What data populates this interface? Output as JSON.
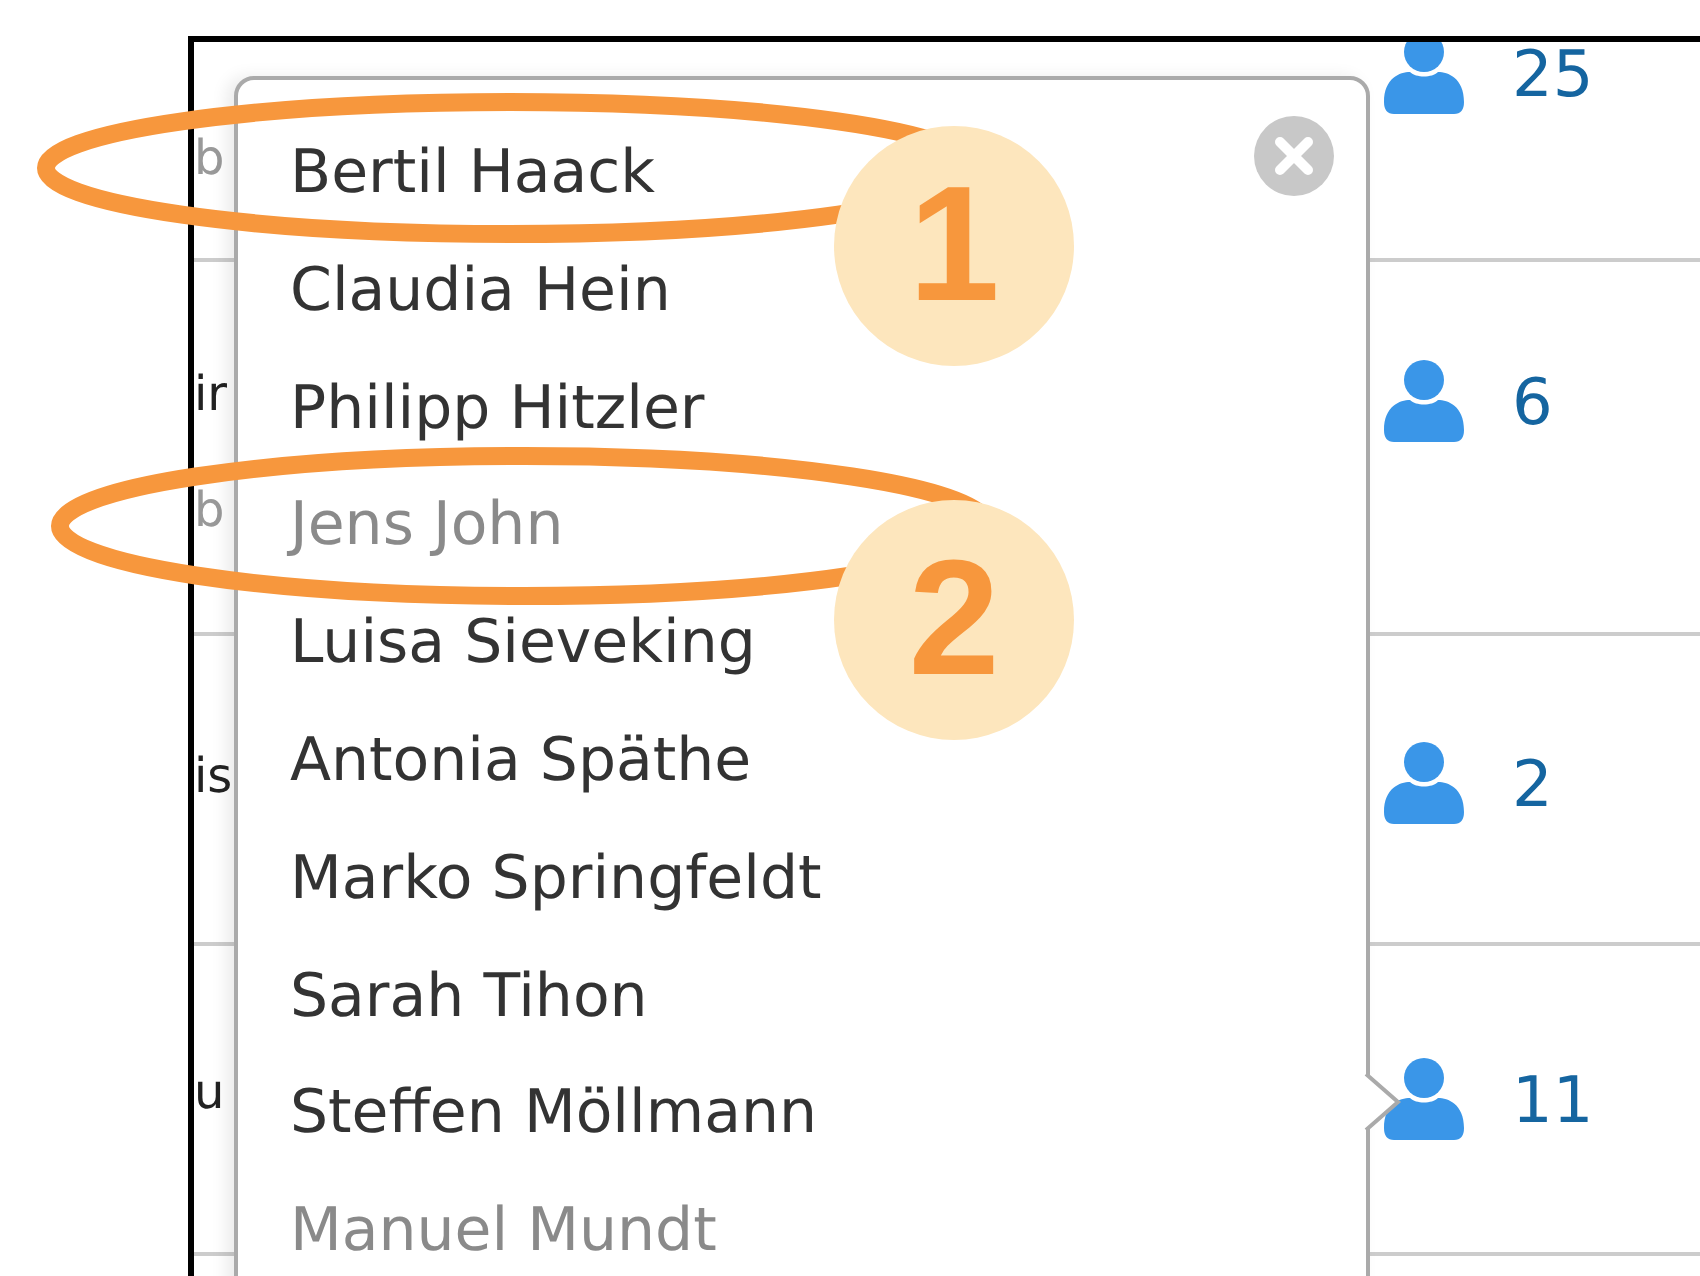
{
  "table": {
    "rows": [
      {
        "texts": [
          {
            "text": "b",
            "kind": "subtitle"
          }
        ],
        "count": "25"
      },
      {
        "texts": [
          {
            "text": "ir",
            "kind": "title"
          },
          {
            "text": "b",
            "kind": "subtitle"
          }
        ],
        "count": "6"
      },
      {
        "texts": [
          {
            "text": "is",
            "kind": "title"
          }
        ],
        "count": "2"
      },
      {
        "texts": [
          {
            "text": "u",
            "kind": "title"
          }
        ],
        "count": "11"
      }
    ]
  },
  "popover": {
    "items": [
      {
        "name": "Bertil Haack",
        "disabled": false
      },
      {
        "name": "Claudia Hein",
        "disabled": false
      },
      {
        "name": "Philipp Hitzler",
        "disabled": false
      },
      {
        "name": "Jens John",
        "disabled": true
      },
      {
        "name": "Luisa Sieveking",
        "disabled": false
      },
      {
        "name": "Antonia Späthe",
        "disabled": false
      },
      {
        "name": "Marko Springfeldt",
        "disabled": false
      },
      {
        "name": "Sarah Tihon",
        "disabled": false
      },
      {
        "name": "Steffen Möllmann",
        "disabled": false
      },
      {
        "name": "Manuel Mundt",
        "disabled": true
      }
    ]
  },
  "annotations": [
    {
      "number": "1"
    },
    {
      "number": "2"
    }
  ]
}
